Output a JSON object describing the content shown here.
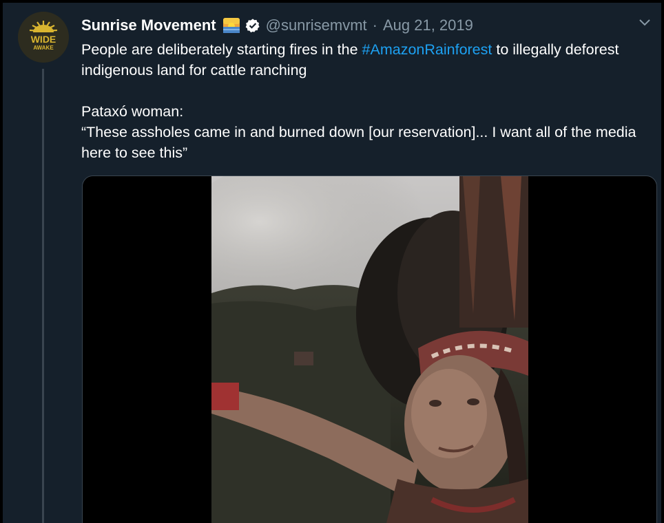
{
  "tweet": {
    "author_name": "Sunrise Movement",
    "handle": "@sunrisemvmt",
    "separator": "·",
    "date": "Aug 21, 2019",
    "avatar_text_top": "WIDE",
    "avatar_text_bottom": "AWAKE",
    "text_line1_before": "People are deliberately starting fires in the ",
    "hashtag": "#AmazonRainforest",
    "text_line1_after": " to illegally deforest indigenous land for cattle ranching",
    "text_para2_line1": "Pataxó woman:",
    "text_para2_line2": "“These assholes came in and burned down [our reservation]... I want all of the media here to see this”"
  },
  "icons": {
    "emoji": "sunrise-emoji-icon",
    "verified": "verified-badge-icon",
    "caret": "chevron-down-icon"
  },
  "colors": {
    "background": "#15202b",
    "primary_text": "#ffffff",
    "secondary_text": "#8899a6",
    "link": "#1da1f2",
    "verified": "#ffffff"
  }
}
